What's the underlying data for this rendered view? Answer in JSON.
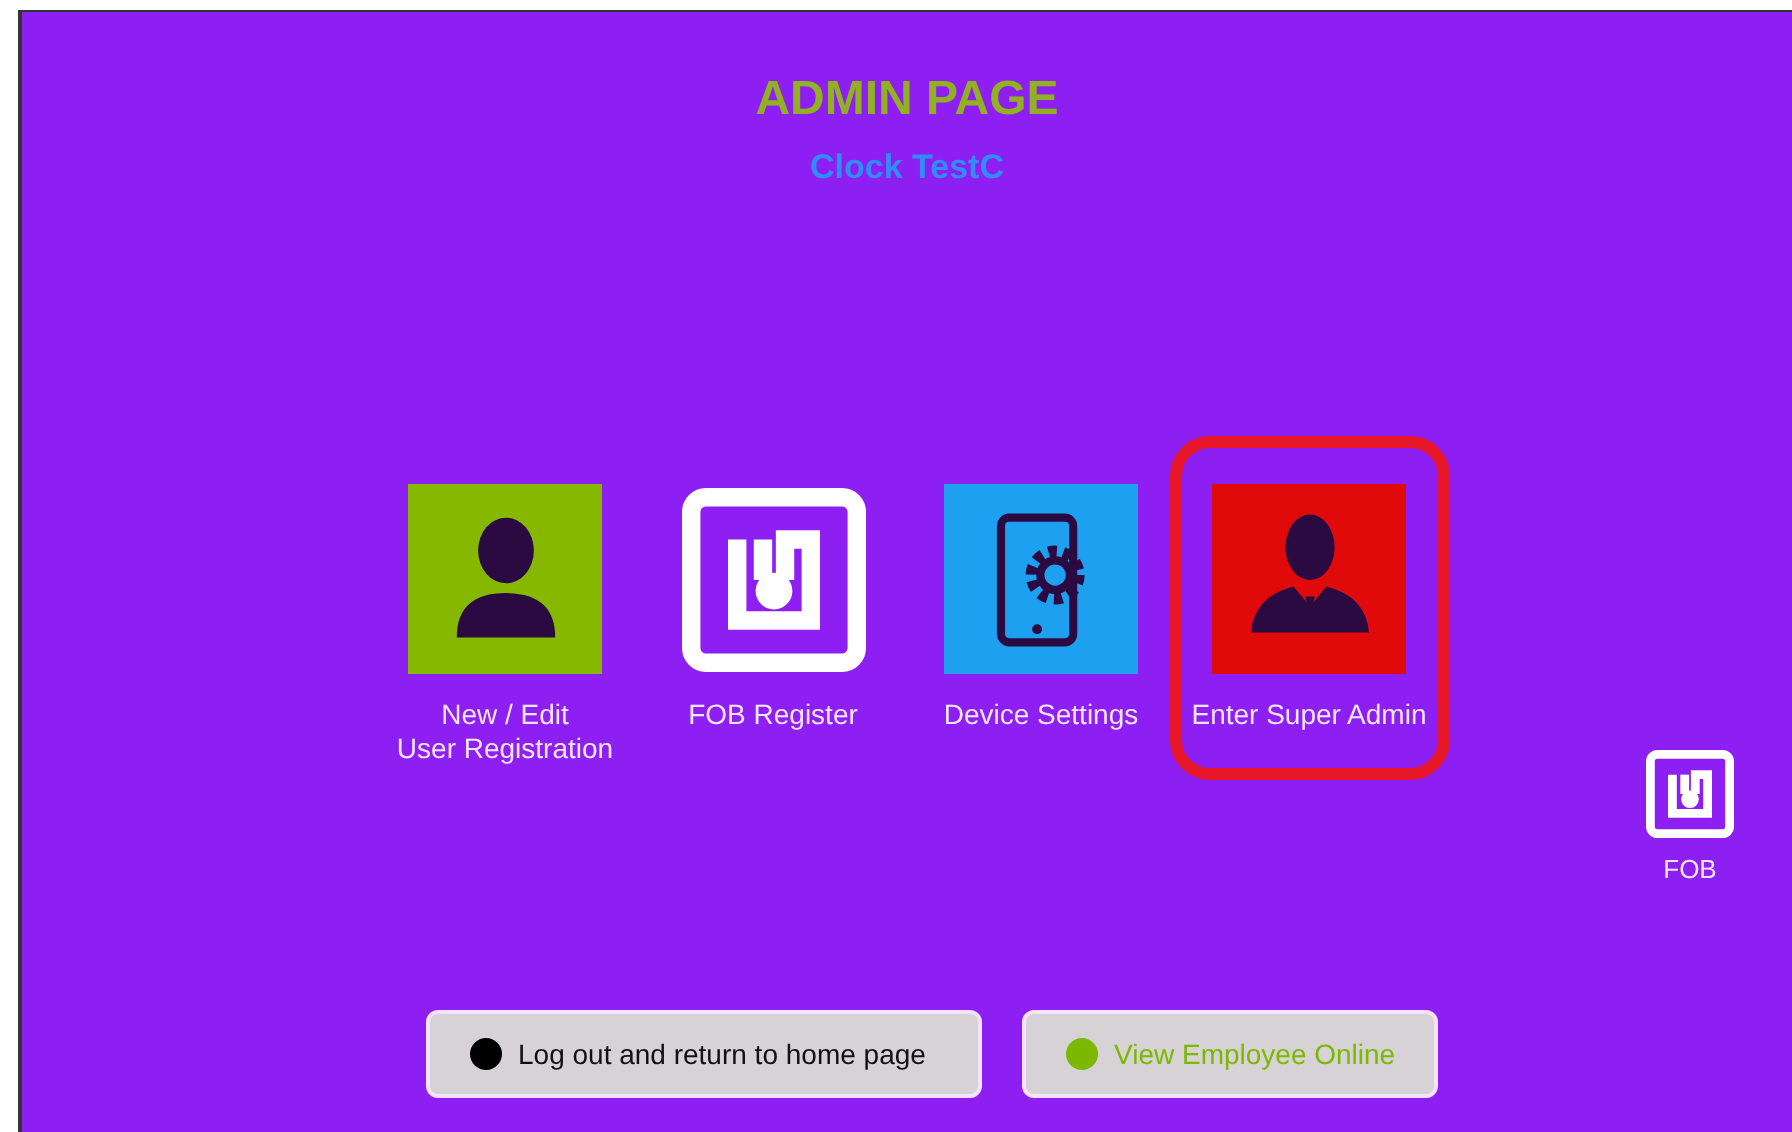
{
  "title": "ADMIN PAGE",
  "subtitle": "Clock TestC",
  "tiles": [
    {
      "kind": "person",
      "label": "New / Edit\nUser Registration",
      "highlighted": false
    },
    {
      "kind": "fob",
      "label": "FOB Register",
      "highlighted": false
    },
    {
      "kind": "device",
      "label": "Device Settings",
      "highlighted": false
    },
    {
      "kind": "admin",
      "label": "Enter Super Admin",
      "highlighted": true
    }
  ],
  "side_button": {
    "label": "FOB"
  },
  "buttons": [
    {
      "label": "Log out and return to home page",
      "color": "#000000"
    },
    {
      "label": "View Employee Online",
      "color": "#7cb800"
    }
  ]
}
